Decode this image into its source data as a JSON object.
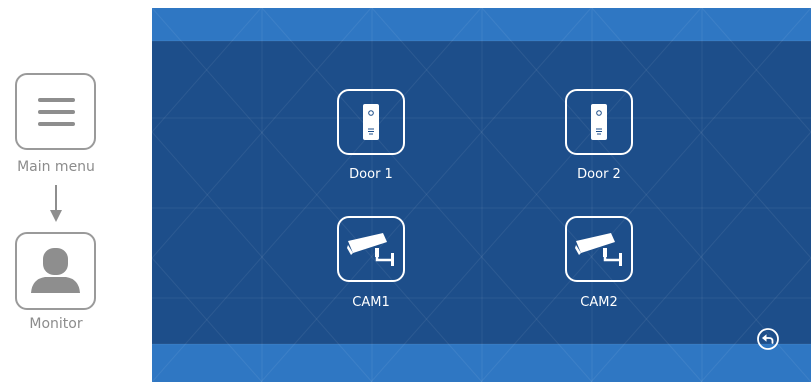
{
  "guide": {
    "steps": [
      {
        "label": "Main menu",
        "icon": "menu-icon"
      },
      {
        "label": "Monitor",
        "icon": "person-icon"
      }
    ],
    "arrow_icon": "arrow-down-icon"
  },
  "screen": {
    "tiles": [
      {
        "label": "Door 1",
        "icon": "door-station-icon"
      },
      {
        "label": "Door 2",
        "icon": "door-station-icon"
      },
      {
        "label": "CAM1",
        "icon": "cctv-camera-icon"
      },
      {
        "label": "CAM2",
        "icon": "cctv-camera-icon"
      }
    ],
    "back_icon": "back-icon"
  },
  "colors": {
    "screen_background": "#1d4e8a",
    "band": "#2f77c3",
    "foreground": "#ffffff",
    "guide_gray": "#8e8e8e"
  }
}
